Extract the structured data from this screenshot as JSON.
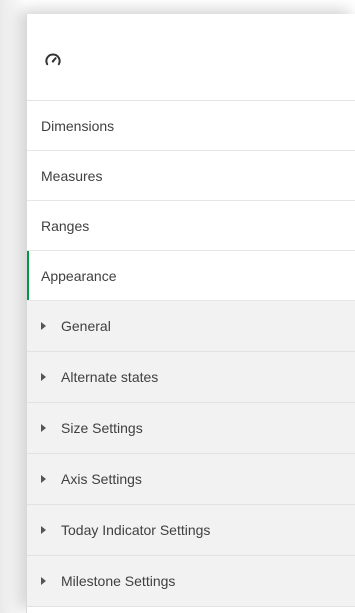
{
  "header": {
    "icon": "gauge-icon"
  },
  "nav": {
    "items": [
      {
        "label": "Dimensions"
      },
      {
        "label": "Measures"
      },
      {
        "label": "Ranges"
      },
      {
        "label": "Appearance",
        "active": true
      }
    ]
  },
  "appearance": {
    "sections": [
      {
        "label": "General",
        "icon": "caret-right-icon"
      },
      {
        "label": "Alternate states",
        "icon": "caret-right-icon"
      },
      {
        "label": "Size Settings",
        "icon": "caret-right-icon"
      },
      {
        "label": "Axis Settings",
        "icon": "caret-right-icon"
      },
      {
        "label": "Today Indicator Settings",
        "icon": "caret-right-icon"
      },
      {
        "label": "Milestone Settings",
        "icon": "caret-right-icon"
      }
    ]
  },
  "colors": {
    "active_accent": "#009845",
    "section_bg": "#f2f2f2",
    "text": "#404040"
  }
}
